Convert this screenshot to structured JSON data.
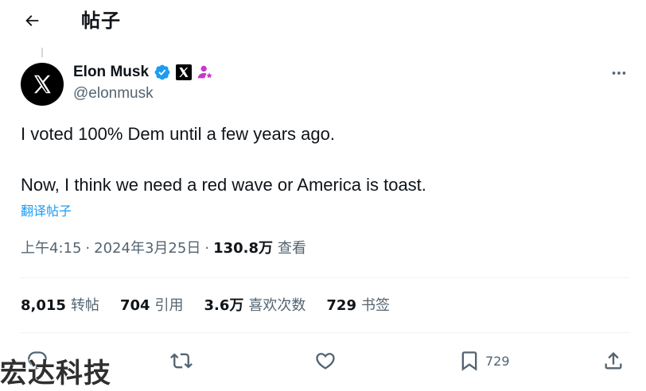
{
  "header": {
    "title": "帖子"
  },
  "author": {
    "display_name": "Elon Musk",
    "handle": "@elonmusk",
    "avatar_letter": "X"
  },
  "tweet": {
    "text": "I voted 100% Dem until a few years ago.\n\nNow, I think we need a red wave or America is toast.",
    "translate_label": "翻译帖子"
  },
  "meta": {
    "time": "上午4:15",
    "date": "2024年3月25日",
    "separator": "·",
    "views_count": "130.8万",
    "views_label": "查看"
  },
  "stats": [
    {
      "num": "8,015",
      "label": "转帖"
    },
    {
      "num": "704",
      "label": "引用"
    },
    {
      "num": "3.6万",
      "label": "喜欢次数"
    },
    {
      "num": "729",
      "label": "书签"
    }
  ],
  "actions": {
    "reply_icon": "speech-bubble",
    "retweet_icon": "two-arrows-loop",
    "like_icon": "heart",
    "bookmark_icon": "bookmark",
    "bookmark_count": "729",
    "share_icon": "upload-arrow"
  },
  "watermark": {
    "text": "宏达科技"
  },
  "colors": {
    "verified": "#1d9bf0",
    "link": "#1d9bf0",
    "secondary_text": "#536471",
    "primary_text": "#0f1419",
    "affiliate_badge": "#c936cc"
  }
}
